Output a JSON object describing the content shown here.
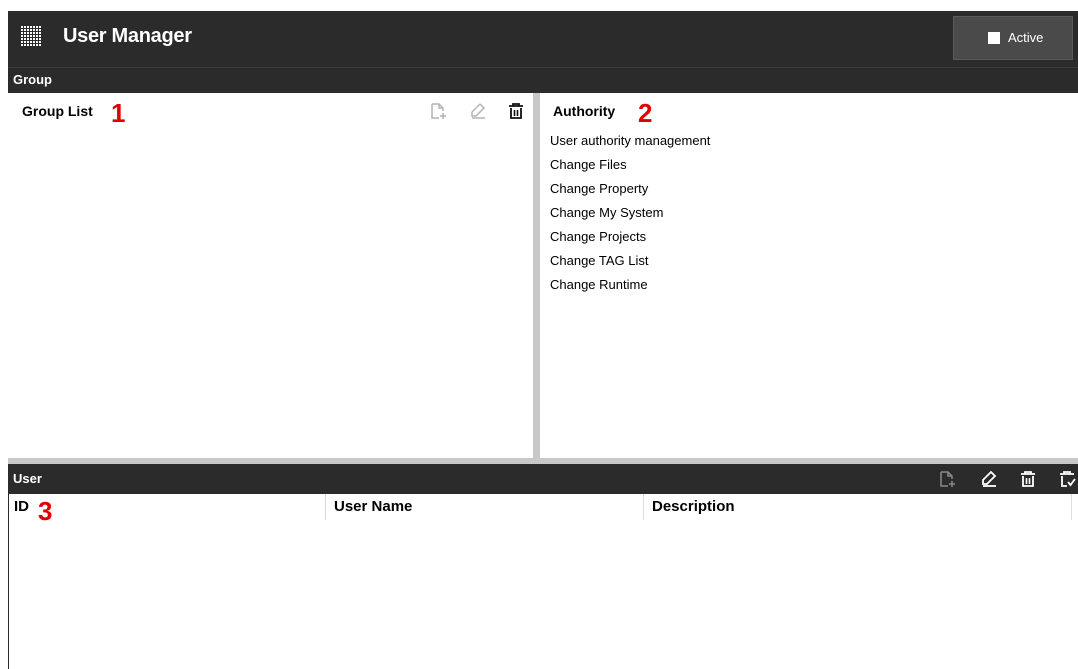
{
  "header": {
    "title": "User Manager",
    "menu_icon": "grid-menu-icon",
    "active_label": "Active"
  },
  "group": {
    "section_label": "Group",
    "group_list": {
      "title": "Group List",
      "marker": "1",
      "tools": [
        "add-document-icon",
        "edit-icon",
        "delete-icon"
      ]
    },
    "authority": {
      "title": "Authority",
      "marker": "2",
      "items": [
        "User authority management",
        "Change Files",
        "Change Property",
        "Change My System",
        "Change Projects",
        "Change TAG List",
        "Change Runtime"
      ]
    }
  },
  "user": {
    "section_label": "User",
    "tools": [
      "add-document-icon",
      "edit-icon",
      "delete-icon",
      "delete-checked-icon"
    ],
    "marker": "3",
    "columns": [
      "ID",
      "User Name",
      "Description"
    ],
    "rows": []
  },
  "colors": {
    "dark_bar": "#2b2b2b",
    "splitter": "#c8c8c8",
    "marker_red": "#e00000",
    "icon_disabled": "#b4b4b4"
  }
}
